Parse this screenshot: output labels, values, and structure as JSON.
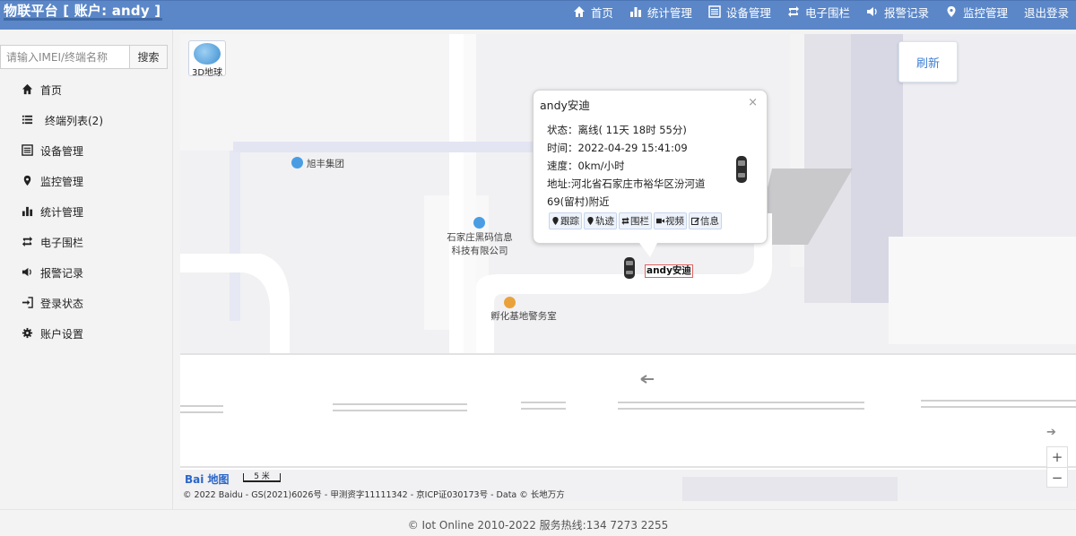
{
  "header": {
    "brand": "物联平台 [ 账户: andy ]",
    "nav": [
      {
        "label": "首页",
        "icon": "home-icon"
      },
      {
        "label": "统计管理",
        "icon": "bar-chart-icon"
      },
      {
        "label": "设备管理",
        "icon": "list-icon"
      },
      {
        "label": "电子围栏",
        "icon": "retweet-icon"
      },
      {
        "label": "报警记录",
        "icon": "volume-icon"
      },
      {
        "label": "监控管理",
        "icon": "map-marker-icon"
      },
      {
        "label": "退出登录",
        "icon": ""
      }
    ]
  },
  "sidebar": {
    "search_placeholder": "请输入IMEI/终端名称",
    "search_value": "",
    "search_button": "搜索",
    "items": [
      {
        "label": "首页",
        "icon": "home-icon"
      },
      {
        "label": "终端列表(2)",
        "icon": "list-icon"
      },
      {
        "label": "设备管理",
        "icon": "list-alt-icon"
      },
      {
        "label": "监控管理",
        "icon": "map-marker-icon"
      },
      {
        "label": "统计管理",
        "icon": "bar-chart-icon"
      },
      {
        "label": "电子围栏",
        "icon": "retweet-icon"
      },
      {
        "label": "报警记录",
        "icon": "volume-icon"
      },
      {
        "label": "登录状态",
        "icon": "sign-in-icon"
      },
      {
        "label": "账户设置",
        "icon": "gear-icon"
      }
    ]
  },
  "map": {
    "btn_3d_label": "3D地球",
    "refresh_label": "刷新",
    "pois": {
      "xufeng": "旭丰集团",
      "heima_line1": "石家庄黑码信息",
      "heima_line2": "科技有限公司",
      "police": "孵化基地警务室"
    },
    "info_window": {
      "title": "andy安迪",
      "close": "×",
      "status": "状态：离线( 11天 18时 55分)",
      "time": "时间：2022-04-29 15:41:09",
      "speed": "速度：0km/小时",
      "address_line1": "地址:河北省石家庄市裕华区汾河道",
      "address_line2": "69(留村)附近",
      "actions": [
        {
          "label": "跟踪",
          "icon": "map-marker-icon"
        },
        {
          "label": "轨迹",
          "icon": "map-marker-icon"
        },
        {
          "label": "围栏",
          "icon": "retweet-icon"
        },
        {
          "label": "视频",
          "icon": "video-icon"
        },
        {
          "label": "信息",
          "icon": "edit-icon"
        }
      ]
    },
    "vehicle_label": "andy安迪",
    "zoom_in": "+",
    "zoom_out": "−",
    "logo": "Bai 地图",
    "scale": "5 米",
    "copyright": "© 2022 Baidu - GS(2021)6026号 - 甲测资字11111342 - 京ICP证030173号 - Data © 长地万方"
  },
  "footer": {
    "text": "© Iot Online 2010-2022 服务热线:134 7273 2255"
  },
  "colors": {
    "navbar": "#5b87c8",
    "accent": "#3f7fd4",
    "map_bg": "#f1f1f3"
  }
}
